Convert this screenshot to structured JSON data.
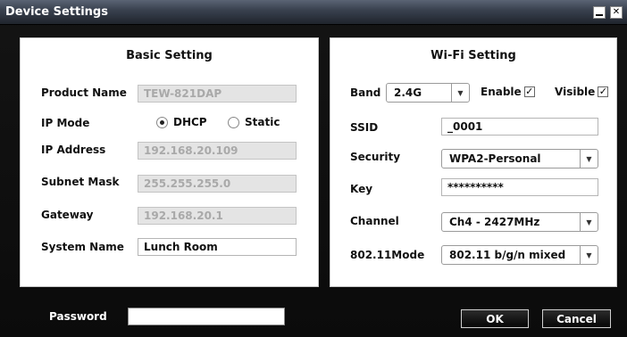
{
  "window": {
    "title": "Device Settings",
    "minimize_glyph": "",
    "close_glyph": "✕"
  },
  "basic": {
    "title": "Basic Setting",
    "product_name_label": "Product Name",
    "product_name_value": "TEW-821DAP",
    "ip_mode_label": "IP Mode",
    "dhcp_label": "DHCP",
    "static_label": "Static",
    "ip_mode_selected": "DHCP",
    "ip_address_label": "IP Address",
    "ip_address_value": "192.168.20.109",
    "subnet_mask_label": "Subnet Mask",
    "subnet_mask_value": "255.255.255.0",
    "gateway_label": "Gateway",
    "gateway_value": "192.168.20.1",
    "system_name_label": "System Name",
    "system_name_value": "Lunch Room"
  },
  "wifi": {
    "title": "Wi-Fi Setting",
    "band_label": "Band",
    "band_value": "2.4G",
    "enable_label": "Enable",
    "enable_checked": true,
    "visible_label": "Visible",
    "visible_checked": true,
    "ssid_label": "SSID",
    "ssid_value": "_0001",
    "security_label": "Security",
    "security_value": "WPA2-Personal",
    "key_label": "Key",
    "key_value": "**********",
    "channel_label": "Channel",
    "channel_value": "Ch4 - 2427MHz",
    "mode_label": "802.11Mode",
    "mode_value": "802.11 b/g/n mixed"
  },
  "footer": {
    "password_label": "Password",
    "password_value": "",
    "ok_label": "OK",
    "cancel_label": "Cancel"
  },
  "icons": {
    "dropdown": "▼",
    "check": "✓"
  }
}
